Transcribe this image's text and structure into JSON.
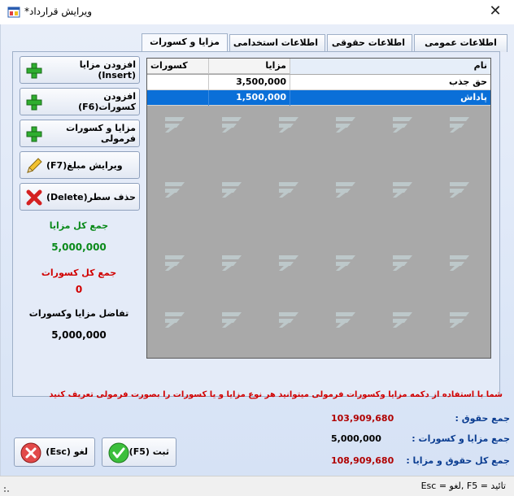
{
  "window": {
    "title": "ویرایش قرارداد*"
  },
  "tabs": [
    {
      "label": "اطلاعات عمومی",
      "active": false
    },
    {
      "label": "اطلاعات حقوقی",
      "active": false
    },
    {
      "label": "اطلاعات استخدامی",
      "active": false
    },
    {
      "label": "مزایا و کسورات",
      "active": true
    }
  ],
  "actions": {
    "add_benefit": "افزودن مزایا (Insert)",
    "add_deduction": "افزودن کسورات(F6)",
    "formula": "مزایا و کسورات فرمولی",
    "edit_amount": "ویرایش مبلغ(F7)",
    "delete_row": "حذف سطر(Delete)"
  },
  "stats": {
    "total_benefits_label": "جمع کل مزایا",
    "total_benefits_value": "5,000,000",
    "total_deductions_label": "جمع کل کسورات",
    "total_deductions_value": "0",
    "difference_label": "تفاضل مزایا وکسورات",
    "difference_value": "5,000,000"
  },
  "grid": {
    "columns": [
      "نام",
      "مزایا",
      "کسورات"
    ],
    "rows": [
      {
        "name": "حق جذب",
        "benefit": "3,500,000",
        "deduction": "",
        "selected": false
      },
      {
        "name": "پاداش",
        "benefit": "1,500,000",
        "deduction": "",
        "selected": true
      }
    ]
  },
  "hint": "شما با استفاده از دکمه مزایا وکسورات فرمولی میتوانید هر نوع مزایا و یا کسورات را بصورت فرمولی تعریف کنید",
  "summary": {
    "salary_label": "جمع حقوق :",
    "salary_value": "103,909,680",
    "benefits_label": "جمع مزایا و کسورات :",
    "benefits_value": "5,000,000",
    "total_label": "جمع کل حقوق و مزایا :",
    "total_value": "108,909,680"
  },
  "buttons": {
    "save": "ثبت (F5)",
    "cancel": "لغو (Esc)"
  },
  "status": {
    "text": "تائید = F5 ,لغو = Esc"
  },
  "colors": {
    "accent_red": "#d10000",
    "accent_green": "#0a8a1a",
    "selection_blue": "#0a6fd8",
    "summary_label_blue": "#0b3d91",
    "summary_value_red": "#b00000"
  }
}
